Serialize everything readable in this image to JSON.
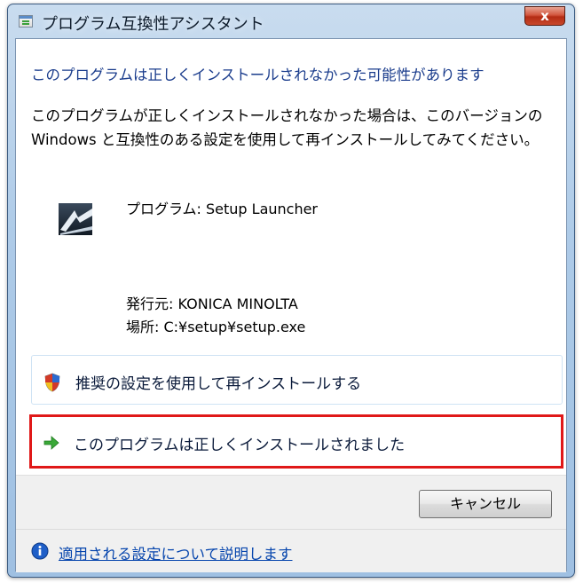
{
  "window": {
    "title": "プログラム互換性アシスタント",
    "close_symbol": "x"
  },
  "main": {
    "heading": "このプログラムは正しくインストールされなかった可能性があります",
    "description": "このプログラムが正しくインストールされなかった場合は、このバージョンの Windows と互換性のある設定を使用して再インストールしてみてください。",
    "program": "プログラム: Setup Launcher",
    "publisher": "発行元: KONICA MINOLTA",
    "location": "場所: C:¥setup¥setup.exe"
  },
  "options": [
    {
      "label": "推奨の設定を使用して再インストールする",
      "icon": "shield-icon"
    },
    {
      "label": "このプログラムは正しくインストールされました",
      "icon": "green-arrow-icon"
    }
  ],
  "buttons": {
    "cancel": "キャンセル"
  },
  "help": {
    "link": "適用される設定について説明します",
    "icon": "info-icon"
  },
  "colors": {
    "heading": "#1a3c8c",
    "highlight_border": "#e01818",
    "link": "#0645ad"
  }
}
